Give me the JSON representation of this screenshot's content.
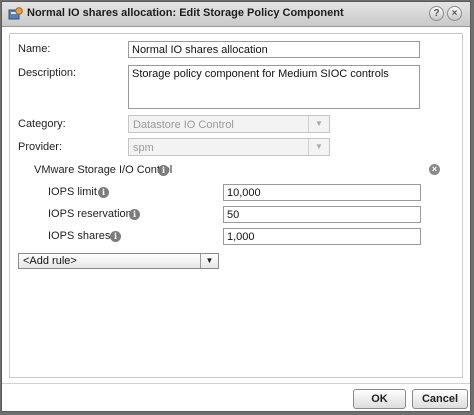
{
  "window": {
    "title": "Normal IO shares allocation: Edit Storage Policy Component",
    "help_glyph": "?",
    "close_glyph": "×",
    "icon": "storage-policy-icon"
  },
  "form": {
    "name_label": "Name:",
    "name_value": "Normal IO shares allocation",
    "description_label": "Description:",
    "description_value": "Storage policy component for Medium SIOC controls",
    "category_label": "Category:",
    "category_value": "Datastore IO Control",
    "provider_label": "Provider:",
    "provider_value": "spm"
  },
  "section": {
    "title": "VMware Storage I/O Control",
    "rows": [
      {
        "label": "IOPS limit",
        "value": "10,000"
      },
      {
        "label": "IOPS reservation",
        "value": "50"
      },
      {
        "label": "IOPS shares",
        "value": "1,000"
      }
    ],
    "info_glyph": "i",
    "remove_glyph": "×"
  },
  "add_rule": {
    "label": "<Add rule>",
    "arrow": "▼"
  },
  "buttons": {
    "ok": "OK",
    "cancel": "Cancel"
  }
}
